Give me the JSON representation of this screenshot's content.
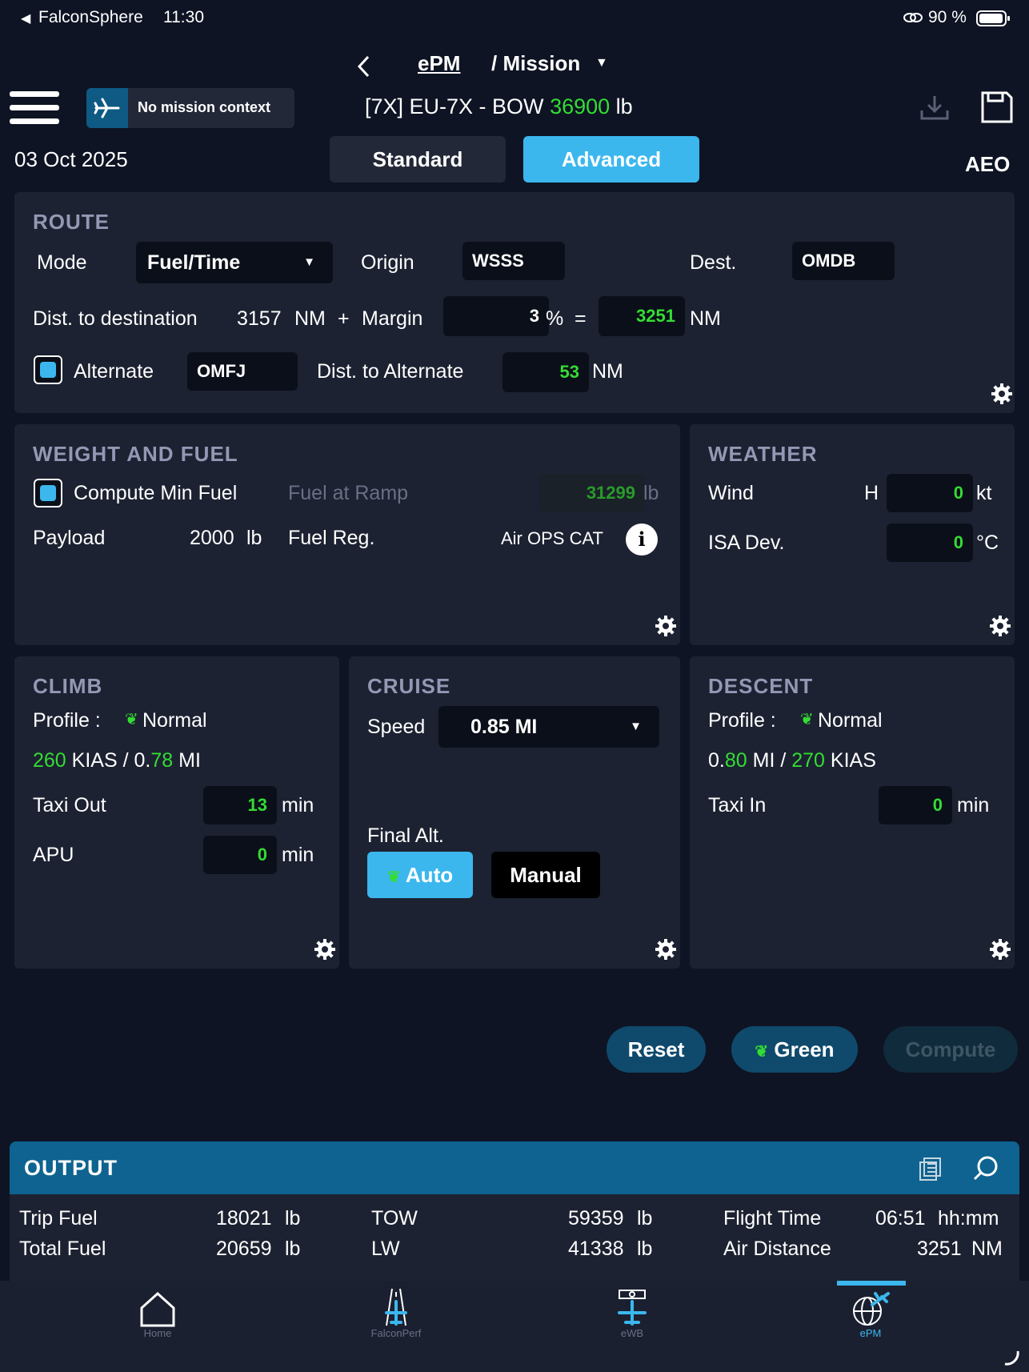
{
  "status_bar": {
    "back_app": "FalconSphere",
    "time": "11:30",
    "battery": "90 %"
  },
  "header": {
    "breadcrumb_app": "ePM",
    "breadcrumb_page": "/ Mission",
    "mission_context": "No mission context",
    "aircraft_prefix": "[7X] EU-7X - BOW",
    "bow_value": "36900",
    "bow_unit": "lb",
    "date": "03 Oct 2025",
    "mode_standard": "Standard",
    "mode_advanced": "Advanced",
    "engine_mode": "AEO"
  },
  "route": {
    "title": "ROUTE",
    "mode_label": "Mode",
    "mode_value": "Fuel/Time",
    "origin_label": "Origin",
    "origin_value": "WSSS",
    "dest_label": "Dest.",
    "dest_value": "OMDB",
    "dist_label": "Dist. to destination",
    "dist_value": "3157",
    "dist_unit": "NM",
    "plus": "+",
    "margin_label": "Margin",
    "margin_value": "3",
    "percent": "%",
    "equals": "=",
    "total_value": "3251",
    "total_unit": "NM",
    "alternate_label": "Alternate",
    "alternate_value": "OMFJ",
    "dist_alt_label": "Dist. to Alternate",
    "dist_alt_value": "53",
    "dist_alt_unit": "NM"
  },
  "weight_fuel": {
    "title": "WEIGHT AND FUEL",
    "compute_min_fuel": "Compute Min Fuel",
    "fuel_ramp_label": "Fuel at Ramp",
    "fuel_ramp_value": "31299",
    "fuel_ramp_unit": "lb",
    "payload_label": "Payload",
    "payload_value": "2000",
    "payload_unit": "lb",
    "fuel_reg_label": "Fuel Reg.",
    "fuel_reg_value": "Air OPS CAT"
  },
  "weather": {
    "title": "WEATHER",
    "wind_label": "Wind",
    "wind_dir": "H",
    "wind_value": "0",
    "wind_unit": "kt",
    "isa_label": "ISA Dev.",
    "isa_value": "0",
    "isa_unit": "°C"
  },
  "climb": {
    "title": "CLIMB",
    "profile_label": "Profile :",
    "profile_value": "Normal",
    "speed_kias": "260",
    "kias": "KIAS",
    "slash_zero": "/ 0.",
    "speed_mi": "78",
    "mi": "MI",
    "taxi_out_label": "Taxi Out",
    "taxi_out_value": "13",
    "taxi_out_unit": "min",
    "apu_label": "APU",
    "apu_value": "0",
    "apu_unit": "min"
  },
  "cruise": {
    "title": "CRUISE",
    "speed_label": "Speed",
    "speed_value": "0.85 MI",
    "final_alt_label": "Final Alt.",
    "auto": "Auto",
    "manual": "Manual"
  },
  "descent": {
    "title": "DESCENT",
    "profile_label": "Profile :",
    "profile_value": "Normal",
    "zero": "0.",
    "speed_mi": "80",
    "mi_slash": "MI /",
    "speed_kias": "270",
    "kias": "KIAS",
    "taxi_in_label": "Taxi In",
    "taxi_in_value": "0",
    "taxi_in_unit": "min"
  },
  "actions": {
    "reset": "Reset",
    "green": "Green",
    "compute": "Compute"
  },
  "output": {
    "title": "OUTPUT",
    "trip_fuel_label": "Trip Fuel",
    "trip_fuel_value": "18021",
    "trip_fuel_unit": "lb",
    "total_fuel_label": "Total Fuel",
    "total_fuel_value": "20659",
    "total_fuel_unit": "lb",
    "tow_label": "TOW",
    "tow_value": "59359",
    "tow_unit": "lb",
    "lw_label": "LW",
    "lw_value": "41338",
    "lw_unit": "lb",
    "flight_time_label": "Flight Time",
    "flight_time_value": "06:51",
    "flight_time_unit": "hh:mm",
    "air_dist_label": "Air Distance",
    "air_dist_value": "3251",
    "air_dist_unit": "NM"
  },
  "tabbar": {
    "home": "Home",
    "falconperf": "FalconPerf",
    "ewb": "eWB",
    "epm": "ePM"
  },
  "colors": {
    "accent_blue": "#3bb7ee",
    "value_green": "#33dd33",
    "output_header": "#0e6390"
  }
}
